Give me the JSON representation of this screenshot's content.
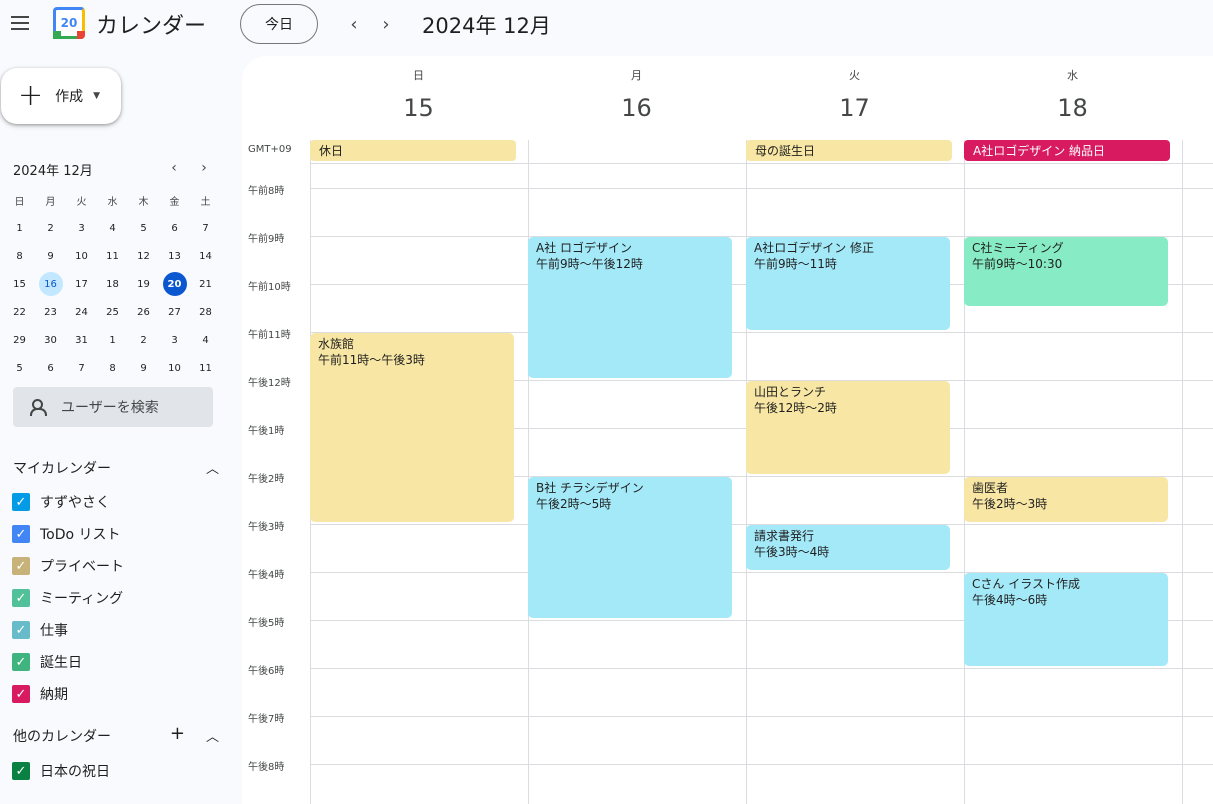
{
  "header": {
    "app_title": "カレンダー",
    "logo_day": "20",
    "today_label": "今日",
    "prev_icon": "‹",
    "next_icon": "›",
    "period": "2024年 12月"
  },
  "sidebar": {
    "create_label": "作成",
    "mini_calendar": {
      "title": "2024年 12月",
      "weekdays": [
        "日",
        "月",
        "火",
        "水",
        "木",
        "金",
        "土"
      ],
      "weeks": [
        [
          "1",
          "2",
          "3",
          "4",
          "5",
          "6",
          "7"
        ],
        [
          "8",
          "9",
          "10",
          "11",
          "12",
          "13",
          "14"
        ],
        [
          "15",
          "16",
          "17",
          "18",
          "19",
          "20",
          "21"
        ],
        [
          "22",
          "23",
          "24",
          "25",
          "26",
          "27",
          "28"
        ],
        [
          "29",
          "30",
          "31",
          "1",
          "2",
          "3",
          "4"
        ],
        [
          "5",
          "6",
          "7",
          "8",
          "9",
          "10",
          "11"
        ]
      ],
      "selected": "16",
      "today": "20"
    },
    "user_search": "ユーザーを検索",
    "my_calendars": {
      "heading": "マイカレンダー",
      "items": [
        {
          "label": "すずやさく",
          "color": "#039be5"
        },
        {
          "label": "ToDo リスト",
          "color": "#4285f4"
        },
        {
          "label": "プライベート",
          "color": "#c7b27a"
        },
        {
          "label": "ミーティング",
          "color": "#52c098"
        },
        {
          "label": "仕事",
          "color": "#68bcc9"
        },
        {
          "label": "誕生日",
          "color": "#3fb47e"
        },
        {
          "label": "納期",
          "color": "#d81b60"
        }
      ]
    },
    "other_calendars": {
      "heading": "他のカレンダー",
      "items": [
        {
          "label": "日本の祝日",
          "color": "#0b8043"
        }
      ]
    }
  },
  "grid": {
    "timezone": "GMT+09",
    "days": [
      {
        "dow": "日",
        "num": "15"
      },
      {
        "dow": "月",
        "num": "16"
      },
      {
        "dow": "火",
        "num": "17"
      },
      {
        "dow": "水",
        "num": "18"
      }
    ],
    "hours": [
      "午前8時",
      "午前9時",
      "午前10時",
      "午前11時",
      "午後12時",
      "午後1時",
      "午後2時",
      "午後3時",
      "午後4時",
      "午後5時",
      "午後6時",
      "午後7時",
      "午後8時"
    ],
    "all_day": [
      {
        "day": 0,
        "title": "休日",
        "color": "#f7e6a4",
        "text": "#1f1f1f"
      },
      {
        "day": 2,
        "title": "母の誕生日",
        "color": "#f7e6a4",
        "text": "#1f1f1f"
      },
      {
        "day": 3,
        "title": "A社ロゴデザイン 納品日",
        "color": "#d81b60",
        "text": "#ffffff"
      }
    ],
    "events": [
      {
        "day": 0,
        "start": 11,
        "end": 15,
        "title": "水族館",
        "time": "午前11時～午後3時",
        "color": "#f7e6a4"
      },
      {
        "day": 1,
        "start": 9,
        "end": 12,
        "title": "A社 ロゴデザイン",
        "time": "午前9時～午後12時",
        "color": "#a3e9f8"
      },
      {
        "day": 1,
        "start": 14,
        "end": 17,
        "title": "B社 チラシデザイン",
        "time": "午後2時～5時",
        "color": "#a3e9f8"
      },
      {
        "day": 2,
        "start": 9,
        "end": 11,
        "title": "A社ロゴデザイン 修正",
        "time": "午前9時～11時",
        "color": "#a3e9f8"
      },
      {
        "day": 2,
        "start": 12,
        "end": 14,
        "title": "山田とランチ",
        "time": "午後12時～2時",
        "color": "#f7e6a4"
      },
      {
        "day": 2,
        "start": 15,
        "end": 16,
        "title": "請求書発行",
        "time": "午後3時～4時",
        "color": "#a3e9f8"
      },
      {
        "day": 3,
        "start": 9,
        "end": 10.5,
        "title": "C社ミーティング",
        "time": "午前9時～10:30",
        "color": "#87ecc5"
      },
      {
        "day": 3,
        "start": 14,
        "end": 15,
        "title": "歯医者",
        "time": "午後2時～3時",
        "color": "#f7e6a4"
      },
      {
        "day": 3,
        "start": 16,
        "end": 18,
        "title": "Cさん イラスト作成",
        "time": "午後4時～6時",
        "color": "#a3e9f8"
      }
    ]
  }
}
